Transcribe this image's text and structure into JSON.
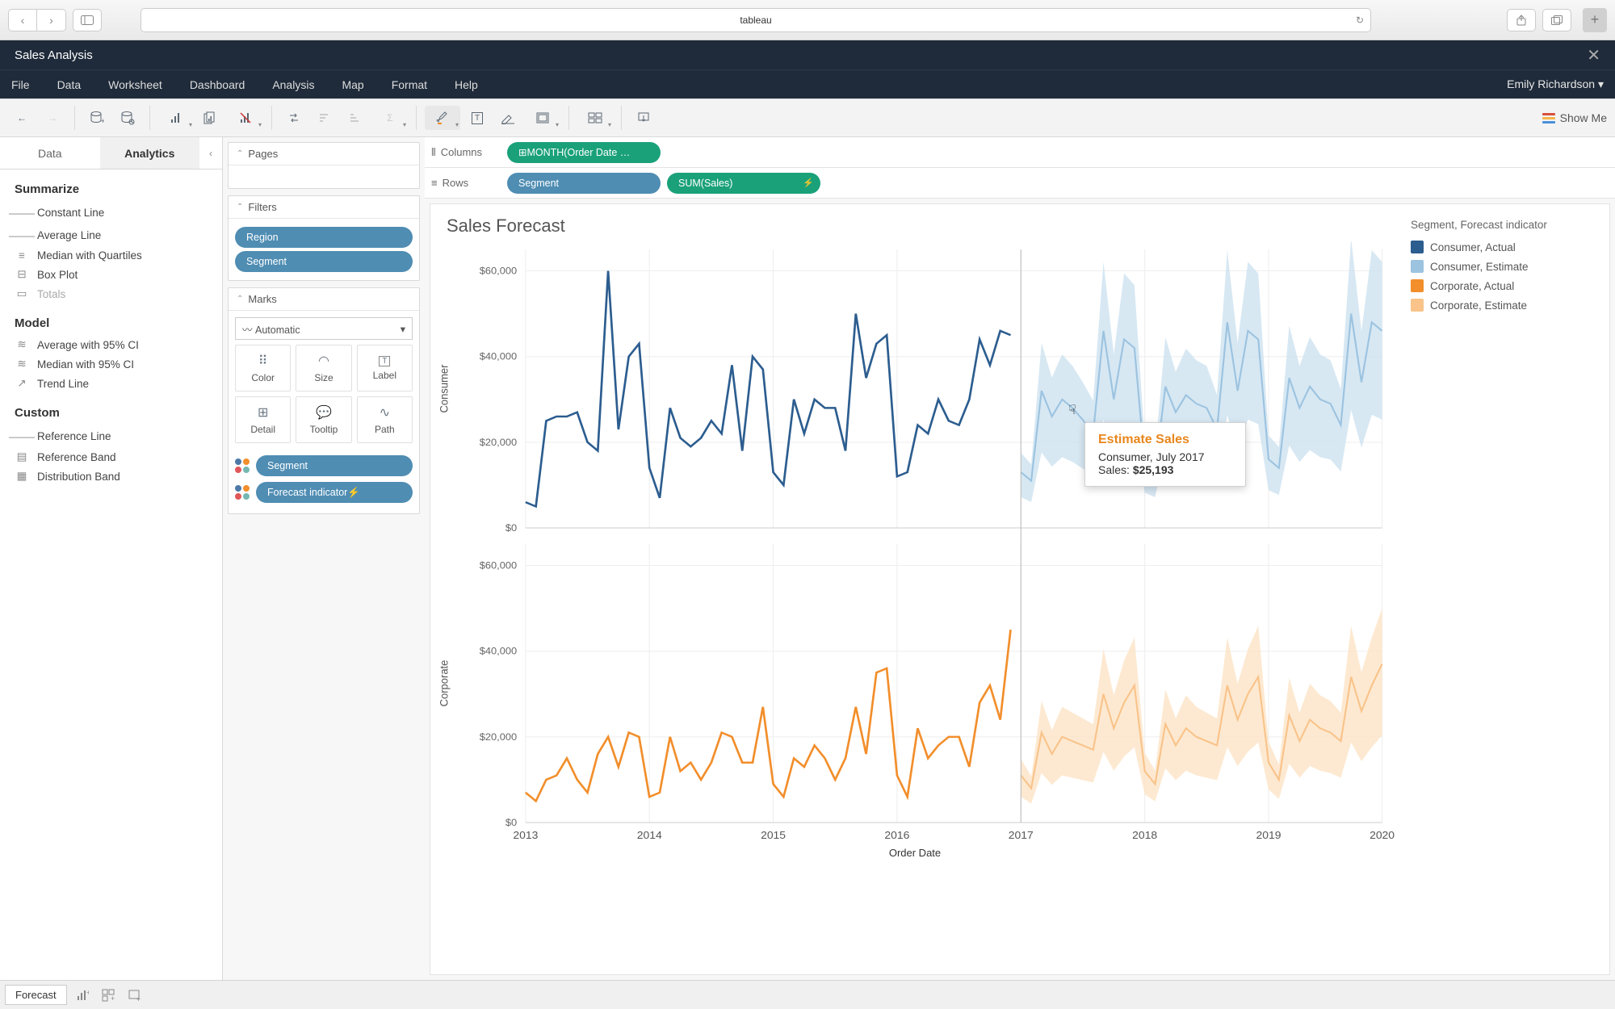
{
  "browser": {
    "title": "tableau"
  },
  "app": {
    "title": "Sales Analysis",
    "user": "Emily Richardson"
  },
  "menus": [
    "File",
    "Data",
    "Worksheet",
    "Dashboard",
    "Analysis",
    "Map",
    "Format",
    "Help"
  ],
  "toolbar": {
    "showme": "Show Me"
  },
  "left": {
    "tabs": {
      "data": "Data",
      "analytics": "Analytics"
    },
    "summarize_h": "Summarize",
    "summarize": [
      "Constant Line",
      "Average Line",
      "Median with Quartiles",
      "Box Plot",
      "Totals"
    ],
    "model_h": "Model",
    "model": [
      "Average with 95% CI",
      "Median with 95% CI",
      "Trend Line"
    ],
    "custom_h": "Custom",
    "custom": [
      "Reference Line",
      "Reference Band",
      "Distribution Band"
    ]
  },
  "shelves": {
    "pages": "Pages",
    "filters": "Filters",
    "filter_pills": [
      "Region",
      "Segment"
    ],
    "marks": "Marks",
    "marks_type": "Automatic",
    "mark_cells": [
      "Color",
      "Size",
      "Label",
      "Detail",
      "Tooltip",
      "Path"
    ],
    "color_pills": [
      "Segment",
      "Forecast indicator"
    ]
  },
  "colrow": {
    "columns": "Columns",
    "columns_pill": "MONTH(Order Date …",
    "rows": "Rows",
    "rows_pill1": "Segment",
    "rows_pill2": "SUM(Sales)"
  },
  "viz": {
    "title": "Sales Forecast",
    "legend_title": "Segment, Forecast indicator",
    "legend": [
      {
        "label": "Consumer, Actual",
        "color": "#2c5d8f"
      },
      {
        "label": "Consumer, Estimate",
        "color": "#9cc3e0"
      },
      {
        "label": "Corporate, Actual",
        "color": "#f28e2b"
      },
      {
        "label": "Corporate, Estimate",
        "color": "#f9c38a"
      }
    ],
    "y_ticks": [
      "$60,000",
      "$40,000",
      "$20,000",
      "$0"
    ],
    "x_ticks": [
      "2013",
      "2014",
      "2015",
      "2016",
      "2017",
      "2018",
      "2019",
      "2020"
    ],
    "panels": [
      "Consumer",
      "Corporate"
    ],
    "x_label": "Order Date",
    "tooltip": {
      "head": "Estimate Sales",
      "line1": "Consumer, July 2017",
      "line2_label": "Sales:",
      "line2_value": "$25,193"
    }
  },
  "footer": {
    "sheet": "Forecast"
  },
  "chart_data": {
    "type": "line",
    "xlabel": "Order Date",
    "ylabel": "Sales",
    "ylim": [
      0,
      65000
    ],
    "x": [
      "2013-01",
      "2013-02",
      "2013-03",
      "2013-04",
      "2013-05",
      "2013-06",
      "2013-07",
      "2013-08",
      "2013-09",
      "2013-10",
      "2013-11",
      "2013-12",
      "2014-01",
      "2014-02",
      "2014-03",
      "2014-04",
      "2014-05",
      "2014-06",
      "2014-07",
      "2014-08",
      "2014-09",
      "2014-10",
      "2014-11",
      "2014-12",
      "2015-01",
      "2015-02",
      "2015-03",
      "2015-04",
      "2015-05",
      "2015-06",
      "2015-07",
      "2015-08",
      "2015-09",
      "2015-10",
      "2015-11",
      "2015-12",
      "2016-01",
      "2016-02",
      "2016-03",
      "2016-04",
      "2016-05",
      "2016-06",
      "2016-07",
      "2016-08",
      "2016-09",
      "2016-10",
      "2016-11",
      "2016-12",
      "2017-01",
      "2017-02",
      "2017-03",
      "2017-04",
      "2017-05",
      "2017-06",
      "2017-07",
      "2017-08",
      "2017-09",
      "2017-10",
      "2017-11",
      "2017-12",
      "2018-01",
      "2018-02",
      "2018-03",
      "2018-04",
      "2018-05",
      "2018-06",
      "2018-07",
      "2018-08",
      "2018-09",
      "2018-10",
      "2018-11",
      "2018-12",
      "2019-01",
      "2019-02",
      "2019-03",
      "2019-04",
      "2019-05",
      "2019-06",
      "2019-07",
      "2019-08",
      "2019-09",
      "2019-10",
      "2019-11",
      "2019-12"
    ],
    "x_ticks": [
      "2013",
      "2014",
      "2015",
      "2016",
      "2017",
      "2018",
      "2019",
      "2020"
    ],
    "series": [
      {
        "name": "Consumer, Actual",
        "color": "#2c5d8f",
        "values": [
          6000,
          5000,
          25000,
          26000,
          26000,
          27000,
          20000,
          18000,
          60000,
          23000,
          40000,
          43000,
          14000,
          7000,
          28000,
          21000,
          19000,
          21000,
          25000,
          22000,
          38000,
          18000,
          40000,
          37000,
          13000,
          10000,
          30000,
          22000,
          30000,
          28000,
          28000,
          18000,
          50000,
          35000,
          43000,
          45000,
          12000,
          13000,
          24000,
          22000,
          30000,
          25000,
          24000,
          30000,
          44000,
          38000,
          46000,
          45000,
          null,
          null,
          null,
          null,
          null,
          null,
          null,
          null,
          null,
          null,
          null,
          null,
          null,
          null,
          null,
          null,
          null,
          null,
          null,
          null,
          null,
          null,
          null,
          null,
          null,
          null,
          null,
          null,
          null,
          null,
          null,
          null,
          null,
          null,
          null,
          null
        ]
      },
      {
        "name": "Consumer, Estimate",
        "color": "#9cc3e0",
        "values": [
          null,
          null,
          null,
          null,
          null,
          null,
          null,
          null,
          null,
          null,
          null,
          null,
          null,
          null,
          null,
          null,
          null,
          null,
          null,
          null,
          null,
          null,
          null,
          null,
          null,
          null,
          null,
          null,
          null,
          null,
          null,
          null,
          null,
          null,
          null,
          null,
          null,
          null,
          null,
          null,
          null,
          null,
          null,
          null,
          null,
          null,
          null,
          null,
          13000,
          11000,
          32000,
          26000,
          30000,
          28000,
          25193,
          22000,
          46000,
          30000,
          44000,
          42000,
          15000,
          13000,
          33000,
          27000,
          31000,
          29000,
          28000,
          23000,
          48000,
          32000,
          46000,
          44000,
          16000,
          14000,
          35000,
          28000,
          33000,
          30000,
          29000,
          24000,
          50000,
          34000,
          48000,
          46000
        ]
      },
      {
        "name": "Corporate, Actual",
        "color": "#f28e2b",
        "values": [
          7000,
          5000,
          10000,
          11000,
          15000,
          10000,
          7000,
          16000,
          20000,
          13000,
          21000,
          20000,
          6000,
          7000,
          20000,
          12000,
          14000,
          10000,
          14000,
          21000,
          20000,
          14000,
          14000,
          27000,
          9000,
          6000,
          15000,
          13000,
          18000,
          15000,
          10000,
          15000,
          27000,
          16000,
          35000,
          36000,
          11000,
          6000,
          22000,
          15000,
          18000,
          20000,
          20000,
          13000,
          28000,
          32000,
          24000,
          45000,
          null,
          null,
          null,
          null,
          null,
          null,
          null,
          null,
          null,
          null,
          null,
          null,
          null,
          null,
          null,
          null,
          null,
          null,
          null,
          null,
          null,
          null,
          null,
          null,
          null,
          null,
          null,
          null,
          null,
          null,
          null,
          null,
          null,
          null,
          null,
          null
        ]
      },
      {
        "name": "Corporate, Estimate",
        "color": "#f9c38a",
        "values": [
          null,
          null,
          null,
          null,
          null,
          null,
          null,
          null,
          null,
          null,
          null,
          null,
          null,
          null,
          null,
          null,
          null,
          null,
          null,
          null,
          null,
          null,
          null,
          null,
          null,
          null,
          null,
          null,
          null,
          null,
          null,
          null,
          null,
          null,
          null,
          null,
          null,
          null,
          null,
          null,
          null,
          null,
          null,
          null,
          null,
          null,
          null,
          null,
          11000,
          8000,
          21000,
          16000,
          20000,
          19000,
          18000,
          17000,
          30000,
          22000,
          28000,
          32000,
          12000,
          9000,
          23000,
          18000,
          22000,
          20000,
          19000,
          18000,
          32000,
          24000,
          30000,
          34000,
          14000,
          10000,
          25000,
          19000,
          24000,
          22000,
          21000,
          19000,
          34000,
          26000,
          32000,
          37000
        ]
      }
    ],
    "forecast_start": "2017-01",
    "panels": [
      "Consumer",
      "Corporate"
    ]
  }
}
